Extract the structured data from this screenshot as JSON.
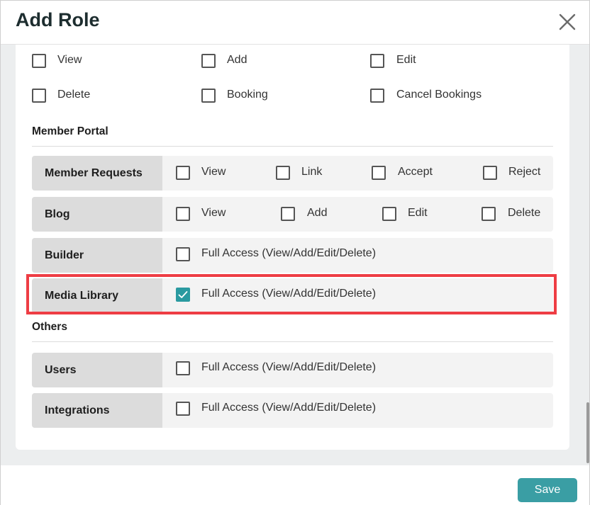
{
  "dialog": {
    "title": "Add Role",
    "close_icon": "close-icon"
  },
  "top_permissions": {
    "row1": [
      {
        "label": "View",
        "checked": false
      },
      {
        "label": "Add",
        "checked": false
      },
      {
        "label": "Edit",
        "checked": false
      }
    ],
    "row2": [
      {
        "label": "Delete",
        "checked": false
      },
      {
        "label": "Booking",
        "checked": false
      },
      {
        "label": "Cancel Bookings",
        "checked": false
      }
    ]
  },
  "member_portal": {
    "title": "Member Portal",
    "rows": [
      {
        "name": "Member Requests",
        "options": [
          {
            "label": "View",
            "checked": false
          },
          {
            "label": "Link",
            "checked": false
          },
          {
            "label": "Accept",
            "checked": false
          },
          {
            "label": "Reject",
            "checked": false
          }
        ]
      },
      {
        "name": "Blog",
        "options": [
          {
            "label": "View",
            "checked": false
          },
          {
            "label": "Add",
            "checked": false
          },
          {
            "label": "Edit",
            "checked": false
          },
          {
            "label": "Delete",
            "checked": false
          }
        ]
      },
      {
        "name": "Builder",
        "options": [
          {
            "label": "Full Access (View/Add/Edit/Delete)",
            "checked": false
          }
        ]
      },
      {
        "name": "Media Library",
        "options": [
          {
            "label": "Full Access (View/Add/Edit/Delete)",
            "checked": true
          }
        ]
      }
    ]
  },
  "others": {
    "title": "Others",
    "rows": [
      {
        "name": "Users",
        "options": [
          {
            "label": "Full Access (View/Add/Edit/Delete)",
            "checked": false
          }
        ]
      },
      {
        "name": "Integrations",
        "options": [
          {
            "label": "Full Access (View/Add/Edit/Delete)",
            "checked": false
          }
        ]
      }
    ]
  },
  "footer": {
    "save_label": "Save"
  },
  "colors": {
    "accent": "#3a9ea4",
    "checkbox_checked": "#2a9aa0",
    "highlight": "#ee3d44"
  }
}
